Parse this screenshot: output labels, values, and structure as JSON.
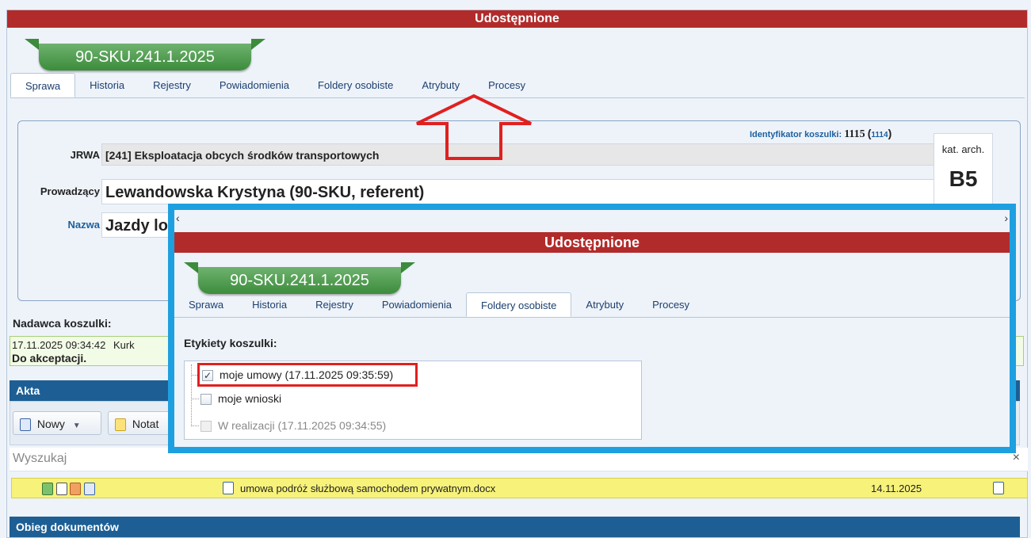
{
  "header": {
    "title": "Udostępnione"
  },
  "case": {
    "number": "90-SKU.241.1.2025"
  },
  "tabs": [
    {
      "label": "Sprawa"
    },
    {
      "label": "Historia"
    },
    {
      "label": "Rejestry"
    },
    {
      "label": "Powiadomienia"
    },
    {
      "label": "Foldery osobiste"
    },
    {
      "label": "Atrybuty"
    },
    {
      "label": "Procesy"
    }
  ],
  "details": {
    "id_label": "Identyfikator koszulki:",
    "id_value": "1115",
    "id_paren_open": "(",
    "id_link": "1114",
    "id_paren_close": ")",
    "jrwa_label": "JRWA",
    "jrwa_value": "[241] Eksploatacja obcych środków transportowych",
    "prowadzacy_label": "Prowadzący",
    "prowadzacy_value": "Lewandowska Krystyna (90-SKU, referent)",
    "nazwa_label": "Nazwa",
    "nazwa_value": "Jazdy lo",
    "kat_label": "kat. arch.",
    "kat_value": "B5"
  },
  "sender": {
    "label": "Nadawca koszulki:",
    "timestamp": "17.11.2025 09:34:42",
    "name": "Kurk",
    "status": "Do akceptacji."
  },
  "akta": {
    "header": "Akta",
    "new_label": "Nowy",
    "note_label": "Notat",
    "search_placeholder": "Wyszukaj",
    "clear_symbol": "×",
    "document": {
      "name": "umowa podróż służbową samochodem prywatnym.docx",
      "date": "14.11.2025"
    }
  },
  "obieg": {
    "header": "Obieg dokumentów"
  },
  "overlay": {
    "title": "Udostępnione",
    "case_number": "90-SKU.241.1.2025",
    "active_tab": "Foldery osobiste",
    "labels_title": "Etykiety koszulki:",
    "labels": [
      {
        "text": "moje umowy (17.11.2025 09:35:59)",
        "checked": true,
        "enabled": true
      },
      {
        "text": "moje wnioski",
        "checked": false,
        "enabled": true
      },
      {
        "text": "W realizacji (17.11.2025 09:34:55)",
        "checked": false,
        "enabled": false
      }
    ]
  },
  "colors": {
    "title_bar": "#b22b2b",
    "case_tab": "#4f9d4f",
    "section_header": "#1d5f94",
    "highlight_row": "#f7f27a",
    "overlay_border": "#1ea0e0",
    "annotation": "#e02020"
  },
  "icons": [
    "word-doc-icon",
    "note-icon",
    "checkbox-icon",
    "arrow-up-annotation-icon",
    "close-icon"
  ]
}
